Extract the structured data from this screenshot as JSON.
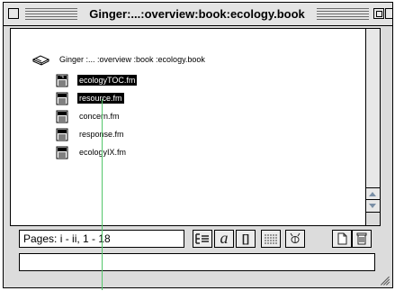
{
  "window": {
    "title": "Ginger:...:overview:book:ecology.book"
  },
  "book": {
    "path": "Ginger :... :overview :book :ecology.book"
  },
  "files": [
    {
      "name": "ecologyTOC.fm",
      "selected": true
    },
    {
      "name": "resource.fm",
      "selected": true
    },
    {
      "name": "concern.fm",
      "selected": false
    },
    {
      "name": "response.fm",
      "selected": false
    },
    {
      "name": "ecologyIX.fm",
      "selected": false
    }
  ],
  "status": {
    "pages_label": "Pages: i - ii, 1 - 18"
  },
  "toolbar": {
    "buttons": [
      {
        "name": "structure-icon",
        "glyph": "⁝≡"
      },
      {
        "name": "italic-a-icon",
        "glyph": "a"
      },
      {
        "name": "brackets-icon",
        "glyph": "[]"
      },
      {
        "name": "list-icon",
        "glyph": "≣"
      },
      {
        "name": "bee-icon",
        "glyph": "✲"
      },
      {
        "name": "page-icon",
        "glyph": "▯"
      },
      {
        "name": "trash-icon",
        "glyph": "🗑"
      }
    ]
  },
  "colors": {
    "window_bg": "#dcdcdc",
    "selection": "#000000",
    "guide_line": "#53c66a",
    "scroll_arrow": "#7a8fa6"
  }
}
